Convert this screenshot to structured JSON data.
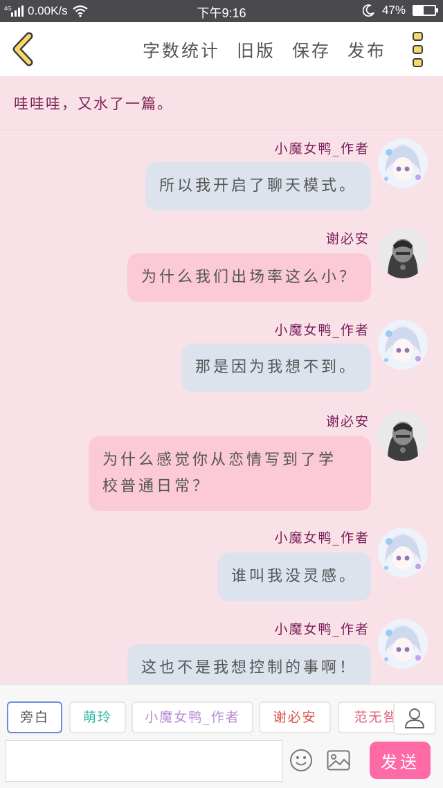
{
  "status_bar": {
    "network": "4G",
    "speed": "0.00K/s",
    "time": "下午9:16",
    "battery": "47%",
    "battery_level": 0.47,
    "icons": [
      "signal-icon",
      "wifi-icon",
      "moon-icon",
      "battery-icon"
    ]
  },
  "toolbar": {
    "word_count": "字数统计",
    "old_version": "旧版",
    "save": "保存",
    "publish": "发布",
    "icons": [
      "back-chevron-icon",
      "more-dots-icon"
    ],
    "accent": "#f6d96b"
  },
  "intro": "哇哇哇，又水了一篇。",
  "messages": [
    {
      "name": "小魔女鸭_作者",
      "text": "所以我开启了聊天模式。",
      "style": "blue",
      "avatar": "anime-girl-avatar"
    },
    {
      "name": "谢必安",
      "text": "为什么我们出场率这么小？",
      "style": "pink",
      "avatar": "masked-character-avatar"
    },
    {
      "name": "小魔女鸭_作者",
      "text": "那是因为我想不到。",
      "style": "blue",
      "avatar": "anime-girl-avatar"
    },
    {
      "name": "谢必安",
      "text_line1": "为什么感觉你从恋情写到了学",
      "text_line2": "校普通日常？",
      "style": "pink",
      "avatar": "masked-character-avatar"
    },
    {
      "name": "小魔女鸭_作者",
      "text": "谁叫我没灵感。",
      "style": "blue",
      "avatar": "anime-girl-avatar"
    },
    {
      "name": "小魔女鸭_作者",
      "text": "这也不是我想控制的事啊！",
      "style": "blue",
      "avatar": "anime-girl-avatar"
    }
  ],
  "roles": [
    {
      "label": "旁白",
      "color": "#555555"
    },
    {
      "label": "萌玲",
      "color": "#2bb3a4"
    },
    {
      "label": "小魔女鸭_作者",
      "color": "#b88ad4"
    },
    {
      "label": "谢必安",
      "color": "#d9534f"
    },
    {
      "label": "范无咎",
      "color": "#e0607e"
    }
  ],
  "input": {
    "placeholder": ""
  },
  "send": "发送",
  "colors": {
    "background": "#f9e1e8",
    "name_color": "#7b1e57",
    "bubble_blue": "#dde3ec",
    "bubble_pink": "#fbcad6",
    "send_button": "#fe6aa5"
  }
}
